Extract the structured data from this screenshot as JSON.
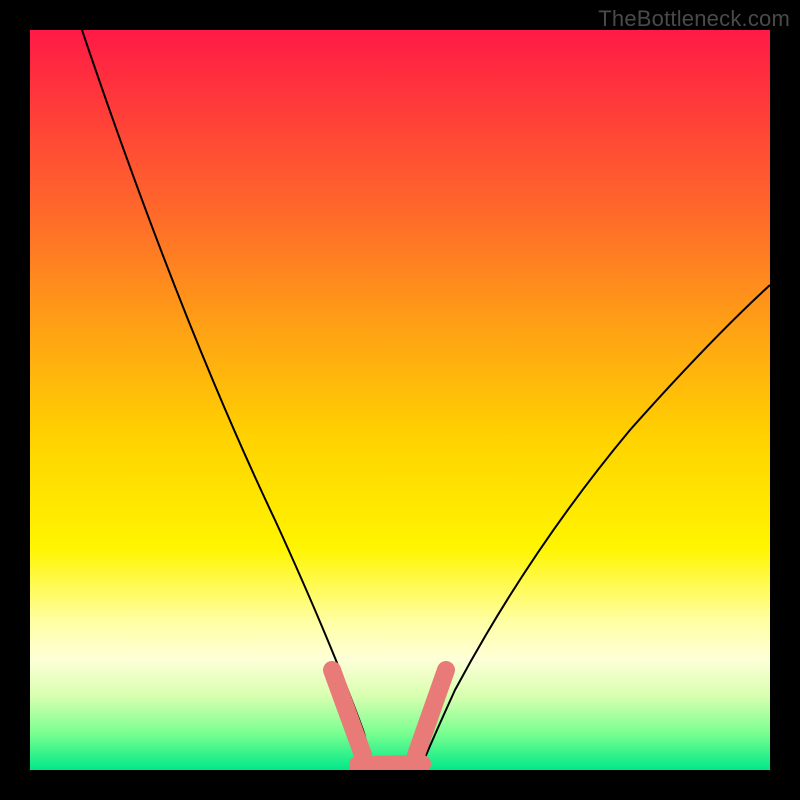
{
  "watermark": "TheBottleneck.com",
  "chart_data": {
    "type": "line",
    "title": "",
    "xlabel": "",
    "ylabel": "",
    "xlim": [
      0,
      100
    ],
    "ylim": [
      0,
      100
    ],
    "grid": false,
    "series": [
      {
        "name": "left-curve",
        "x": [
          7,
          15,
          22,
          28,
          33,
          37,
          40,
          43,
          45
        ],
        "values": [
          100,
          78,
          58,
          42,
          29,
          18,
          10,
          4,
          0
        ]
      },
      {
        "name": "right-curve",
        "x": [
          53,
          56,
          60,
          66,
          74,
          84,
          100
        ],
        "values": [
          0,
          6,
          14,
          25,
          38,
          51,
          70
        ]
      },
      {
        "name": "flat-bottom",
        "x": [
          45,
          53
        ],
        "values": [
          0,
          0
        ]
      }
    ],
    "markers": [
      {
        "name": "left-highlight",
        "x": [
          41,
          45
        ],
        "values": [
          8.5,
          0.5
        ],
        "color": "#e87a78"
      },
      {
        "name": "bottom-highlight",
        "x": [
          44,
          53
        ],
        "values": [
          0,
          0
        ],
        "color": "#e87a78"
      },
      {
        "name": "right-highlight",
        "x": [
          52,
          56
        ],
        "values": [
          0.5,
          8
        ],
        "color": "#e87a78"
      }
    ]
  }
}
